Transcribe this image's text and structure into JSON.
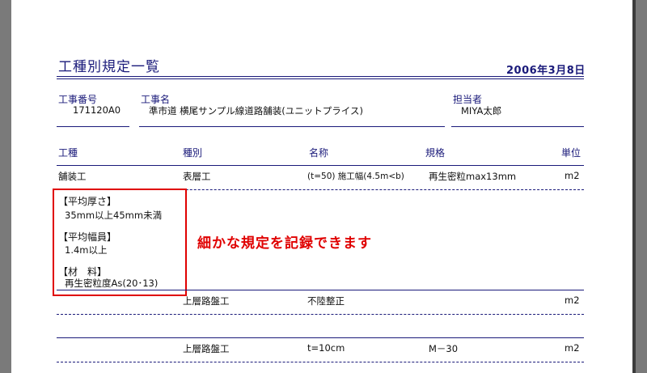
{
  "header": {
    "title": "工種別規定一覧",
    "date": "2006年3月8日"
  },
  "project": {
    "number_label": "工事番号",
    "number_value": "171120A0",
    "name_label": "工事名",
    "name_value": "準市道 横尾サンプル線道路舗装(ユニットプライス)",
    "manager_label": "担当者",
    "manager_value": "MIYA太郎"
  },
  "columns": [
    "工種",
    "種別",
    "名称",
    "規格",
    "単位"
  ],
  "rows": [
    {
      "kind": "舗装工",
      "type": "表層工",
      "name": "(t=50) 施工幅(4.5m<b)",
      "spec": "再生密粒max13mm",
      "unit": "m2"
    },
    {
      "kind": "",
      "type": "上層路盤工",
      "name": "不陸整正",
      "spec": "",
      "unit": "m2"
    },
    {
      "kind": "",
      "type": "上層路盤工",
      "name": "t=10cm",
      "spec": "M－30",
      "unit": "m2"
    }
  ],
  "details": [
    {
      "heading": "【平均厚さ】",
      "value": "35mm以上45mm未満"
    },
    {
      "heading": "【平均幅員】",
      "value": "1.4m以上"
    },
    {
      "heading": "【材　料】",
      "value": "再生密粒度As(20･13)"
    }
  ],
  "annotation": "細かな規定を記録できます",
  "colors": {
    "accent": "#1a1a7a",
    "highlight": "#e00000"
  }
}
